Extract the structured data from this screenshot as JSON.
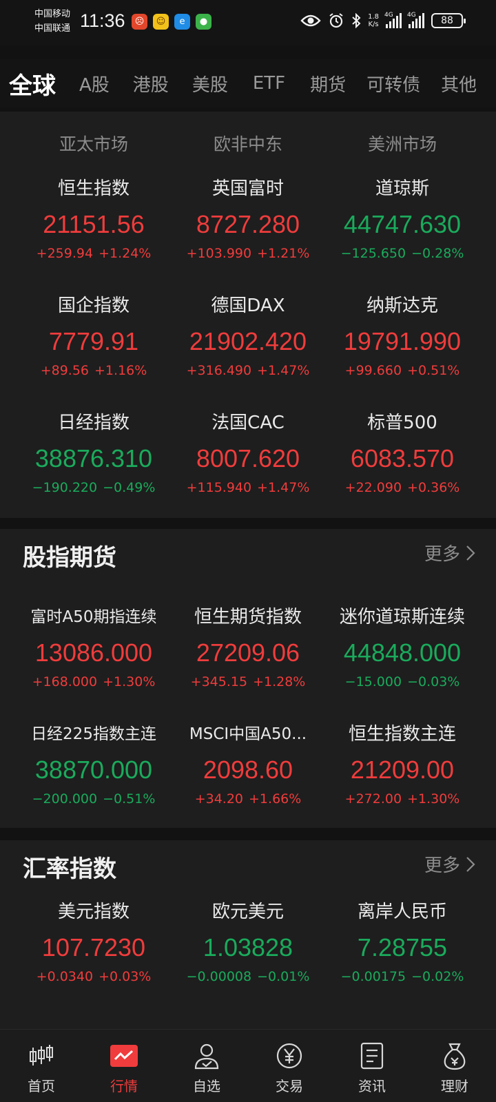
{
  "status_bar": {
    "carrier1": "中国移动",
    "carrier2": "中国联通",
    "time": "11:36",
    "net_speed_value": "1.8",
    "net_speed_unit": "K/s",
    "sim1_type": "4G",
    "sim2_type": "4G",
    "battery": "88"
  },
  "tabs": [
    {
      "label": "全球",
      "active": true
    },
    {
      "label": "A股"
    },
    {
      "label": "港股"
    },
    {
      "label": "美股"
    },
    {
      "label": "ETF"
    },
    {
      "label": "期货"
    },
    {
      "label": "可转债"
    },
    {
      "label": "其他"
    }
  ],
  "global": {
    "regions": [
      "亚太市场",
      "欧非中东",
      "美洲市场"
    ],
    "items": [
      {
        "name": "恒生指数",
        "price": "21151.56",
        "change": "+259.94",
        "pct": "+1.24%",
        "dir": "up"
      },
      {
        "name": "英国富时",
        "price": "8727.280",
        "change": "+103.990",
        "pct": "+1.21%",
        "dir": "up"
      },
      {
        "name": "道琼斯",
        "price": "44747.630",
        "change": "−125.650",
        "pct": "−0.28%",
        "dir": "down"
      },
      {
        "name": "国企指数",
        "price": "7779.91",
        "change": "+89.56",
        "pct": "+1.16%",
        "dir": "up"
      },
      {
        "name": "德国DAX",
        "price": "21902.420",
        "change": "+316.490",
        "pct": "+1.47%",
        "dir": "up"
      },
      {
        "name": "纳斯达克",
        "price": "19791.990",
        "change": "+99.660",
        "pct": "+0.51%",
        "dir": "up"
      },
      {
        "name": "日经指数",
        "price": "38876.310",
        "change": "−190.220",
        "pct": "−0.49%",
        "dir": "down"
      },
      {
        "name": "法国CAC",
        "price": "8007.620",
        "change": "+115.940",
        "pct": "+1.47%",
        "dir": "up"
      },
      {
        "name": "标普500",
        "price": "6083.570",
        "change": "+22.090",
        "pct": "+0.36%",
        "dir": "up"
      }
    ]
  },
  "futures": {
    "title": "股指期货",
    "more": "更多",
    "items": [
      {
        "name": "富时A50期指连续",
        "price": "13086.000",
        "change": "+168.000",
        "pct": "+1.30%",
        "dir": "up"
      },
      {
        "name": "恒生期货指数",
        "price": "27209.06",
        "change": "+345.15",
        "pct": "+1.28%",
        "dir": "up"
      },
      {
        "name": "迷你道琼斯连续",
        "price": "44848.000",
        "change": "−15.000",
        "pct": "−0.03%",
        "dir": "down"
      },
      {
        "name": "日经225指数主连",
        "price": "38870.000",
        "change": "−200.000",
        "pct": "−0.51%",
        "dir": "down"
      },
      {
        "name": "MSCI中国A50...",
        "price": "2098.60",
        "change": "+34.20",
        "pct": "+1.66%",
        "dir": "up"
      },
      {
        "name": "恒生指数主连",
        "price": "21209.00",
        "change": "+272.00",
        "pct": "+1.30%",
        "dir": "up"
      }
    ]
  },
  "fx": {
    "title": "汇率指数",
    "more": "更多",
    "items": [
      {
        "name": "美元指数",
        "price": "107.7230",
        "change": "+0.0340",
        "pct": "+0.03%",
        "dir": "up"
      },
      {
        "name": "欧元美元",
        "price": "1.03828",
        "change": "−0.00008",
        "pct": "−0.01%",
        "dir": "down"
      },
      {
        "name": "离岸人民币",
        "price": "7.28755",
        "change": "−0.00175",
        "pct": "−0.02%",
        "dir": "down"
      }
    ]
  },
  "bottom_nav": [
    {
      "label": "首页",
      "icon": "candlestick-icon"
    },
    {
      "label": "行情",
      "icon": "market-chart-icon",
      "active": true
    },
    {
      "label": "自选",
      "icon": "person-check-icon"
    },
    {
      "label": "交易",
      "icon": "yen-coin-icon"
    },
    {
      "label": "资讯",
      "icon": "document-icon"
    },
    {
      "label": "理财",
      "icon": "money-bag-icon"
    }
  ],
  "colors": {
    "up": "#f03c3c",
    "down": "#1aab5c",
    "background": "#121212",
    "panel": "#1e1e1e"
  }
}
